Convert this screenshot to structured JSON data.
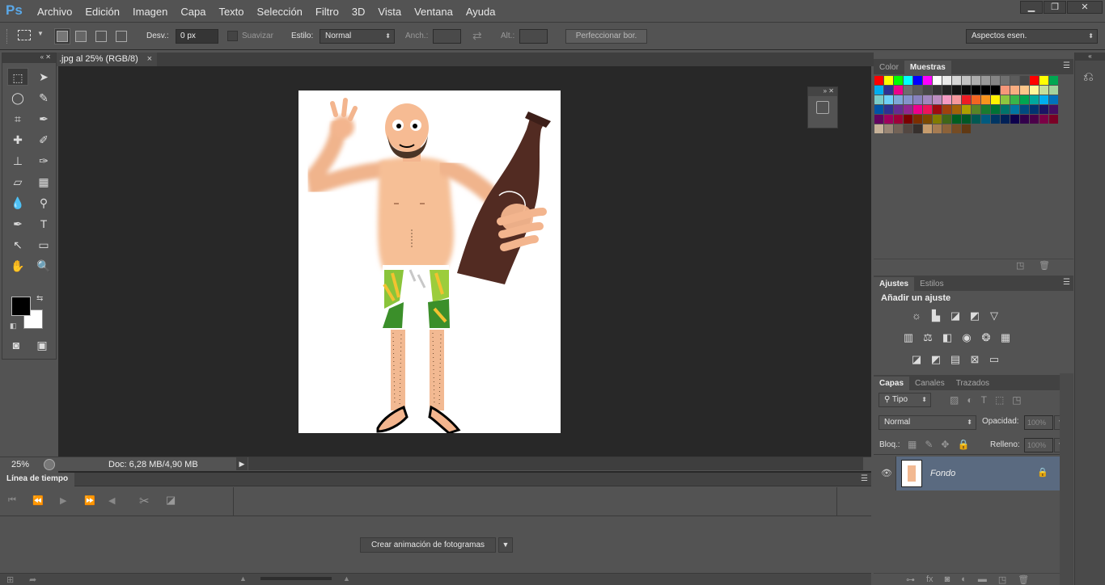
{
  "app": {
    "logo": "Ps"
  },
  "menubar": {
    "items": [
      "Archivo",
      "Edición",
      "Imagen",
      "Capa",
      "Texto",
      "Selección",
      "Filtro",
      "3D",
      "Vista",
      "Ventana",
      "Ayuda"
    ],
    "window_controls": {
      "minimize": "▁",
      "restore": "❐",
      "close": "✕"
    }
  },
  "options": {
    "feather_label": "Desv.:",
    "feather_value": "0 px",
    "antialias_label": "Suavizar",
    "style_label": "Estilo:",
    "style_value": "Normal",
    "width_label": "Anch.:",
    "height_label": "Alt.:",
    "refine_button": "Perfeccionar bor.",
    "workspace": "Aspectos esen."
  },
  "document": {
    "tab_title": ".jpg al 25% (RGB/8)",
    "tab_close": "×"
  },
  "status": {
    "zoom": "25%",
    "doc_info": "Doc: 6,28 MB/4,90 MB"
  },
  "timeline": {
    "tab": "Línea de tiempo",
    "create_button": "Crear animación de fotogramas"
  },
  "panels": {
    "swatches_tabs": [
      "Color",
      "Muestras"
    ],
    "adjustments_tabs": [
      "Ajustes",
      "Estilos"
    ],
    "adjustments_title": "Añadir un ajuste",
    "layers_tabs": [
      "Capas",
      "Canales",
      "Trazados"
    ],
    "filter_kind": "Tipo",
    "blend_mode": "Normal",
    "opacity_label": "Opacidad:",
    "opacity_value": "100%",
    "lock_label": "Bloq.:",
    "fill_label": "Relleno:",
    "fill_value": "100%",
    "layer_name": "Fondo"
  },
  "colors": {
    "foreground": "#000000",
    "background": "#ffffff",
    "canvas_bg": "#282828",
    "selected_layer": "#5a6a80"
  },
  "swatches": [
    "#ff0000",
    "#ffff00",
    "#00ff00",
    "#00ffff",
    "#0000ff",
    "#ff00ff",
    "#ffffff",
    "#ebebeb",
    "#d6d6d6",
    "#c2c2c2",
    "#adadad",
    "#999999",
    "#858585",
    "#707070",
    "#5c5c5c",
    "#474747",
    "#ff0000",
    "#ffff00",
    "#00a651",
    "#00aeef",
    "#2e3192",
    "#ec008c",
    "#6d6d6d",
    "#5a5a5a",
    "#474747",
    "#353535",
    "#242424",
    "#141414",
    "#0a0a0a",
    "#000000",
    "#000000",
    "#000000",
    "#f7977a",
    "#f9ad81",
    "#fdc68a",
    "#fff79a",
    "#c4df9b",
    "#a3d39c",
    "#7accc8",
    "#6ecff6",
    "#7ea7d8",
    "#8493ca",
    "#8882be",
    "#a187be",
    "#bc8dbf",
    "#f49ac2",
    "#f6989d",
    "#ed1c24",
    "#f26522",
    "#f7941d",
    "#fff200",
    "#8dc63f",
    "#39b54a",
    "#00a651",
    "#00a99d",
    "#00aeef",
    "#0072bc",
    "#0054a6",
    "#2e3192",
    "#662d91",
    "#92278f",
    "#ec008c",
    "#ed145b",
    "#9e0b0f",
    "#a0410d",
    "#a36209",
    "#aba000",
    "#598527",
    "#197b30",
    "#007236",
    "#00746b",
    "#0076a3",
    "#004b80",
    "#003471",
    "#1b1464",
    "#440e62",
    "#630460",
    "#9e005d",
    "#9e0039",
    "#790000",
    "#7b2e00",
    "#7d4900",
    "#827b00",
    "#406618",
    "#005e20",
    "#005826",
    "#005952",
    "#005b7f",
    "#003663",
    "#002157",
    "#0d004c",
    "#32004b",
    "#4b0049",
    "#7b0046",
    "#7a0026",
    "#c7b299",
    "#998675",
    "#736357",
    "#534741",
    "#37302d",
    "#c69c6d",
    "#a67c52",
    "#8c6239",
    "#754c24",
    "#603913"
  ]
}
